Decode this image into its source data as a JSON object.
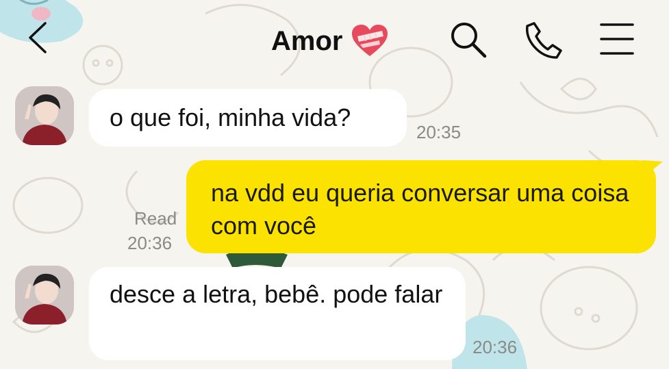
{
  "header": {
    "back_icon": "chevron-left-icon",
    "title": "Amor",
    "title_emoji": "mending-heart-icon",
    "search_icon": "search-icon",
    "call_icon": "phone-icon",
    "menu_icon": "hamburger-menu-icon"
  },
  "messages": [
    {
      "direction": "incoming",
      "text": "o que foi, minha vida?",
      "time": "20:35"
    },
    {
      "direction": "outgoing",
      "text": "na vdd eu queria conversar uma coisa com você",
      "read_label": "Read",
      "time": "20:36"
    },
    {
      "direction": "incoming",
      "text": "desce a letra, bebê. pode falar",
      "time": "20:36"
    }
  ],
  "colors": {
    "outgoing_bubble": "#fbe200",
    "incoming_bubble": "#ffffff",
    "background": "#f6f4ef",
    "timestamp": "#8a8a86"
  }
}
